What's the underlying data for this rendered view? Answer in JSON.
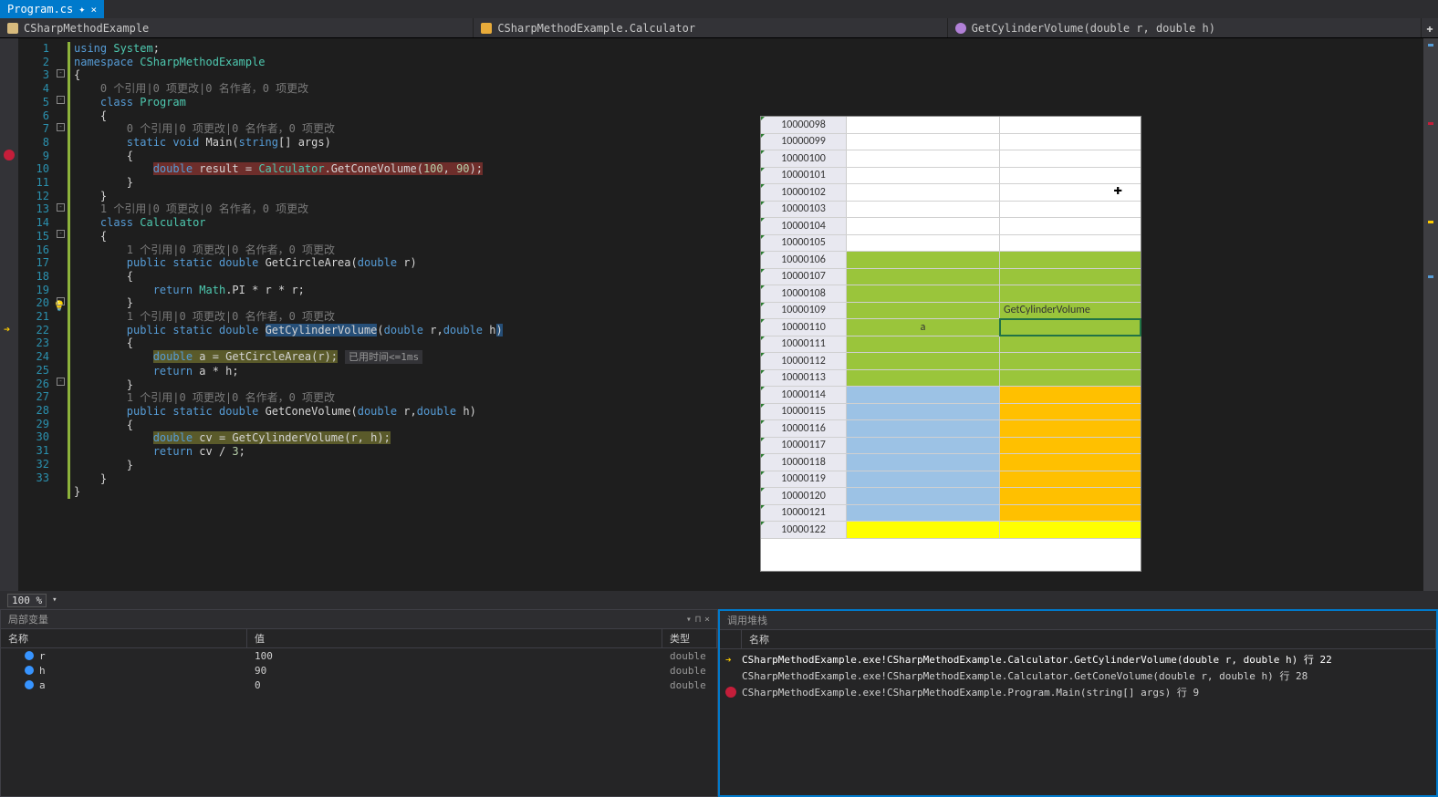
{
  "tab": {
    "name": "Program.cs",
    "dirty_mark": "✦",
    "close": "×"
  },
  "nav": {
    "project": "CSharpMethodExample",
    "class": "CSharpMethodExample.Calculator",
    "method": "GetCylinderVolume(double r, double h)"
  },
  "code": {
    "line_numbers": [
      1,
      2,
      3,
      4,
      5,
      6,
      7,
      8,
      9,
      10,
      11,
      12,
      13,
      14,
      15,
      16,
      17,
      18,
      19,
      20,
      21,
      22,
      23,
      24,
      25,
      26,
      27,
      28,
      29,
      30,
      31,
      32,
      33
    ],
    "ref_hint": "1 个引用|0 项更改|0 名作者，0 项更改",
    "ref_hint_zero": "0 个引用|0 项更改|0 名作者，0 项更改",
    "runtime_hint": "已用时间<=1ms",
    "tokens": {
      "using": "using",
      "system": "System",
      "namespace": "namespace",
      "ns": "CSharpMethodExample",
      "class": "class",
      "program": "Program",
      "calculator": "Calculator",
      "static": "static",
      "void": "void",
      "main": "Main",
      "string": "string",
      "args": "args",
      "double": "double",
      "result": "result",
      "getcone": "GetConeVolume",
      "getcircle": "GetCircleArea",
      "getcyl": "GetCylinderVolume",
      "public": "public",
      "return": "return",
      "math": "Math",
      "pi": "PI",
      "r": "r",
      "h": "h",
      "a": "a",
      "cv": "cv",
      "n100": "100",
      "n90": "90",
      "n3": "3"
    }
  },
  "zoom": "100 %",
  "locals": {
    "title": "局部变量",
    "head_name": "名称",
    "head_value": "值",
    "head_type": "类型",
    "rows": [
      {
        "name": "r",
        "value": "100",
        "type": "double"
      },
      {
        "name": "h",
        "value": "90",
        "type": "double"
      },
      {
        "name": "a",
        "value": "0",
        "type": "double"
      }
    ]
  },
  "callstack": {
    "title": "调用堆栈",
    "head_name": "名称",
    "frames": [
      {
        "icon": "arrow",
        "text": "CSharpMethodExample.exe!CSharpMethodExample.Calculator.GetCylinderVolume(double r, double h) 行 22"
      },
      {
        "icon": "",
        "text": "CSharpMethodExample.exe!CSharpMethodExample.Calculator.GetConeVolume(double r, double h) 行 28"
      },
      {
        "icon": "bp",
        "text": "CSharpMethodExample.exe!CSharpMethodExample.Program.Main(string[] args) 行 9"
      }
    ]
  },
  "overlay": {
    "cell_a": "a",
    "cell_b": "GetCylinderVolume",
    "rows": [
      {
        "n": "10000098",
        "c1": "",
        "c2": ""
      },
      {
        "n": "10000099",
        "c1": "",
        "c2": ""
      },
      {
        "n": "10000100",
        "c1": "",
        "c2": ""
      },
      {
        "n": "10000101",
        "c1": "",
        "c2": ""
      },
      {
        "n": "10000102",
        "c1": "",
        "c2": ""
      },
      {
        "n": "10000103",
        "c1": "",
        "c2": ""
      },
      {
        "n": "10000104",
        "c1": "",
        "c2": ""
      },
      {
        "n": "10000105",
        "c1": "",
        "c2": ""
      },
      {
        "n": "10000106",
        "c1": "g",
        "c2": "g"
      },
      {
        "n": "10000107",
        "c1": "g",
        "c2": "g"
      },
      {
        "n": "10000108",
        "c1": "g",
        "c2": "g"
      },
      {
        "n": "10000109",
        "c1": "g",
        "c2": "g",
        "t2": "GetCylinderVolume"
      },
      {
        "n": "10000110",
        "c1": "g",
        "c2": "g",
        "t1": "a",
        "sel": true
      },
      {
        "n": "10000111",
        "c1": "g",
        "c2": "g"
      },
      {
        "n": "10000112",
        "c1": "g",
        "c2": "g"
      },
      {
        "n": "10000113",
        "c1": "g",
        "c2": "g"
      },
      {
        "n": "10000114",
        "c1": "b",
        "c2": "o"
      },
      {
        "n": "10000115",
        "c1": "b",
        "c2": "o"
      },
      {
        "n": "10000116",
        "c1": "b",
        "c2": "o"
      },
      {
        "n": "10000117",
        "c1": "b",
        "c2": "o"
      },
      {
        "n": "10000118",
        "c1": "b",
        "c2": "o"
      },
      {
        "n": "10000119",
        "c1": "b",
        "c2": "o"
      },
      {
        "n": "10000120",
        "c1": "b",
        "c2": "o"
      },
      {
        "n": "10000121",
        "c1": "b",
        "c2": "o"
      },
      {
        "n": "10000122",
        "c1": "y",
        "c2": "y"
      }
    ]
  }
}
